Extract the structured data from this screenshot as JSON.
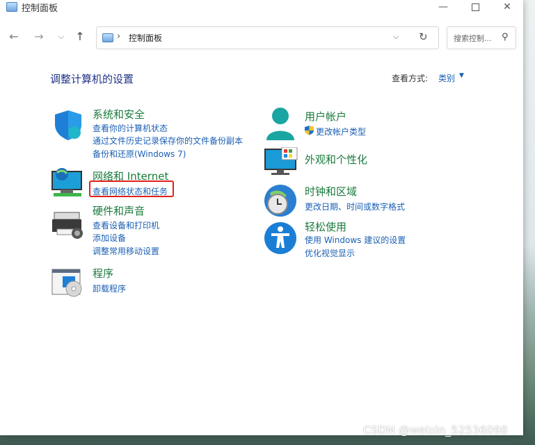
{
  "window": {
    "title": "控制面板"
  },
  "address": {
    "path": "控制面板"
  },
  "search": {
    "placeholder": "搜索控制..."
  },
  "main": {
    "heading": "调整计算机的设置",
    "view_by_label": "查看方式:",
    "view_by_value": "类别"
  },
  "categories": {
    "security": {
      "title": "系统和安全",
      "links": [
        "查看你的计算机状态",
        "通过文件历史记录保存你的文件备份副本",
        "备份和还原(Windows 7)"
      ]
    },
    "network": {
      "title": "网络和 Internet",
      "links": [
        "查看网络状态和任务"
      ]
    },
    "hardware": {
      "title": "硬件和声音",
      "links": [
        "查看设备和打印机",
        "添加设备",
        "调整常用移动设置"
      ]
    },
    "programs": {
      "title": "程序",
      "links": [
        "卸载程序"
      ]
    },
    "users": {
      "title": "用户帐户",
      "links": [
        "更改帐户类型"
      ]
    },
    "appearance": {
      "title": "外观和个性化",
      "links": []
    },
    "clock": {
      "title": "时钟和区域",
      "links": [
        "更改日期、时间或数字格式"
      ]
    },
    "ease": {
      "title": "轻松使用",
      "links": [
        "使用 Windows 建议的设置",
        "优化视觉显示"
      ]
    }
  },
  "watermark": "CSDN @weixin_52536098",
  "colors": {
    "link": "#1a5fb4",
    "category_title": "#1a7a3c",
    "heading": "#1e3287",
    "highlight": "#e0201a"
  }
}
